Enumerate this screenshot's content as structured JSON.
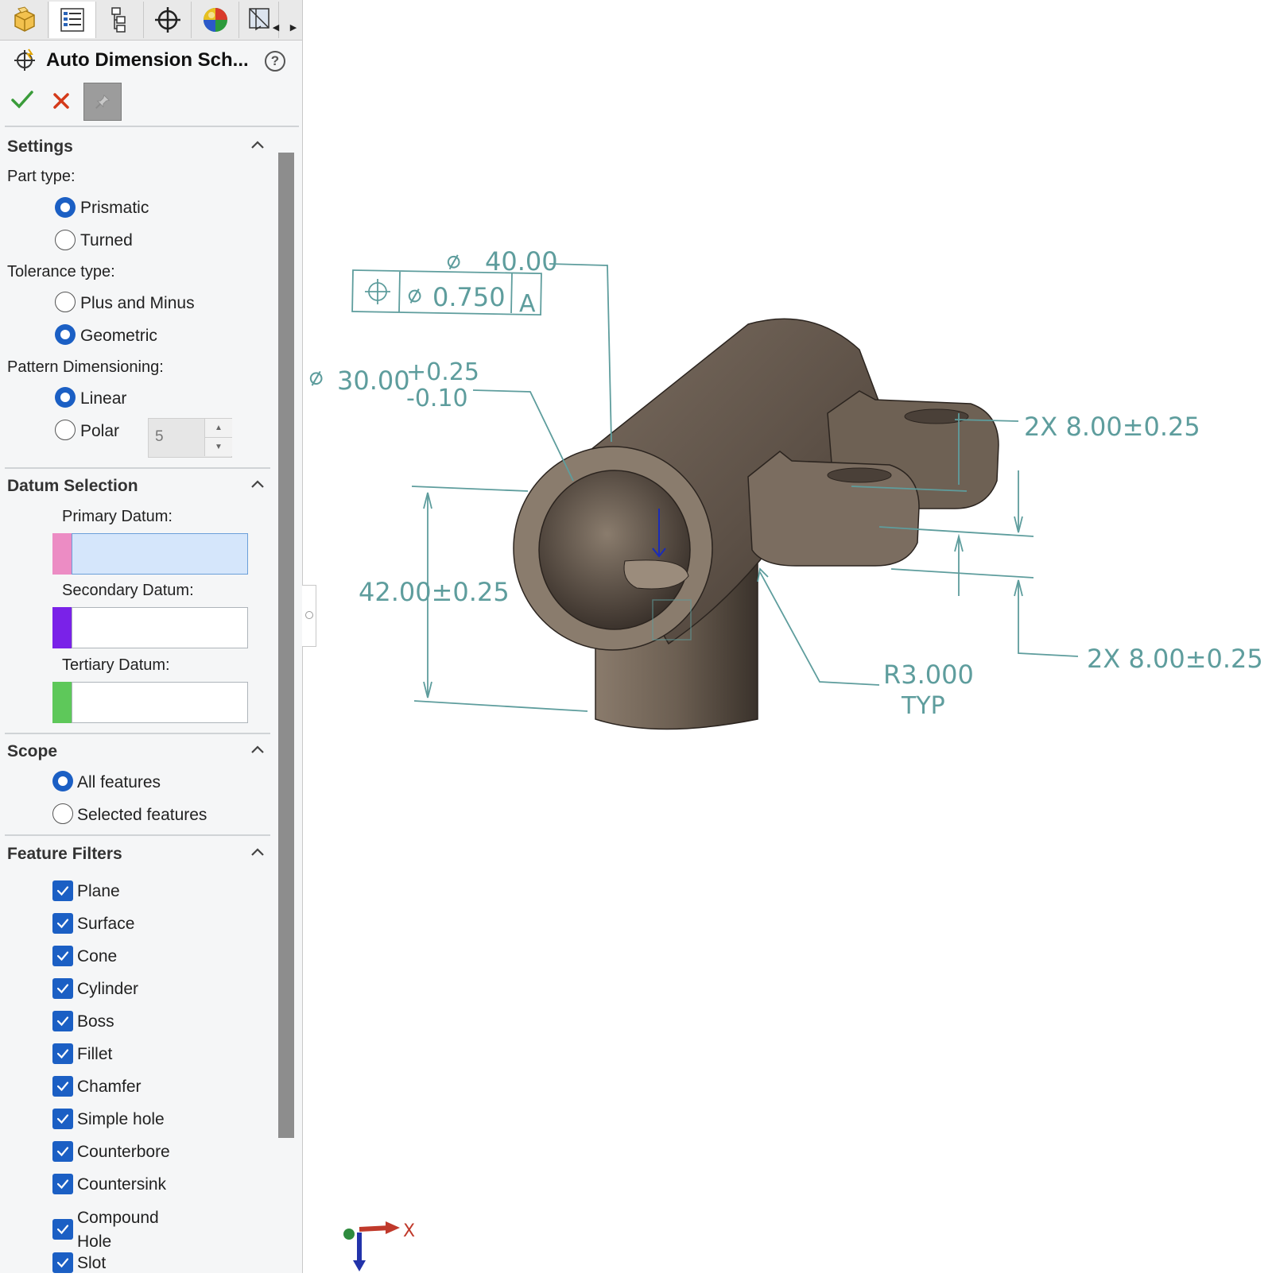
{
  "toolbar": {
    "tabs": [
      "feature-manager-tab",
      "property-manager-tab",
      "configuration-manager-tab",
      "dimxpert-manager-tab",
      "display-manager-tab",
      "cam-tab"
    ]
  },
  "property_manager": {
    "title": "Auto Dimension Sch...",
    "help": "?"
  },
  "settings": {
    "header": "Settings",
    "part_type_label": "Part type:",
    "part_types": [
      "Prismatic",
      "Turned"
    ],
    "part_type_selected": "Prismatic",
    "tolerance_type_label": "Tolerance type:",
    "tolerance_types": [
      "Plus and Minus",
      "Geometric"
    ],
    "tolerance_type_selected": "Geometric",
    "pattern_label": "Pattern Dimensioning:",
    "patterns": [
      "Linear",
      "Polar"
    ],
    "pattern_selected": "Linear",
    "polar_count": "5"
  },
  "datum_selection": {
    "header": "Datum Selection",
    "primary_label": "Primary Datum:",
    "secondary_label": "Secondary Datum:",
    "tertiary_label": "Tertiary Datum:",
    "primary_color": "#ec8cc4",
    "secondary_color": "#7a22e8",
    "tertiary_color": "#5ec85a"
  },
  "scope": {
    "header": "Scope",
    "options": [
      "All features",
      "Selected features"
    ],
    "selected": "All features"
  },
  "feature_filters": {
    "header": "Feature Filters",
    "items": [
      "Plane",
      "Surface",
      "Cone",
      "Cylinder",
      "Boss",
      "Fillet",
      "Chamfer",
      "Simple hole",
      "Counterbore",
      "Countersink",
      "Compound Hole",
      "Slot"
    ]
  },
  "viewport": {
    "dim_40": "40.00",
    "fcf_tol": "0.750",
    "fcf_datum": "A",
    "dim_30": "30.00",
    "dim_30_upper": "+0.25",
    "dim_30_lower": "-0.10",
    "dim_42": "42.00±0.25",
    "dim_8_top": "2X 8.00±0.25",
    "dim_8_bottom": "2X 8.00±0.25",
    "radius": "R3.000",
    "radius_note": "TYP",
    "axis_x": "X",
    "dim_color": "#5e9d9d"
  }
}
